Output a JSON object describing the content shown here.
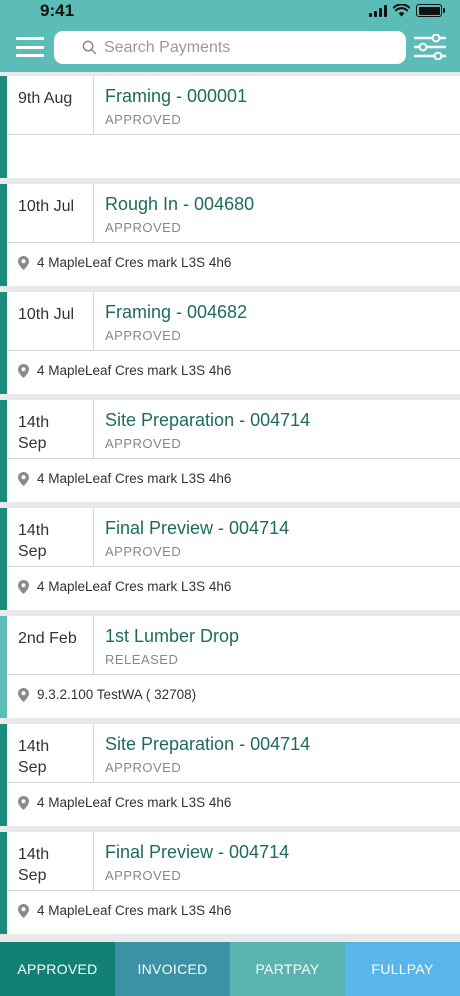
{
  "status_bar": {
    "time": "9:41"
  },
  "search": {
    "placeholder": "Search Payments",
    "value": ""
  },
  "payments": [
    {
      "date": "9th Aug",
      "title": "Framing - 000001",
      "status": "APPROVED",
      "address": ""
    },
    {
      "date": "10th Jul",
      "title": "Rough In - 004680",
      "status": "APPROVED",
      "address": "4 MapleLeaf Cres mark L3S 4h6"
    },
    {
      "date": "10th Jul",
      "title": "Framing - 004682",
      "status": "APPROVED",
      "address": "4 MapleLeaf Cres mark L3S 4h6"
    },
    {
      "date": "14th Sep",
      "title": "Site Preparation - 004714",
      "status": "APPROVED",
      "address": "4 MapleLeaf Cres mark L3S 4h6"
    },
    {
      "date": "14th Sep",
      "title": "Final Preview - 004714",
      "status": "APPROVED",
      "address": "4 MapleLeaf Cres mark L3S 4h6"
    },
    {
      "date": "2nd Feb",
      "title": "1st Lumber Drop",
      "status": "RELEASED",
      "address": "9.3.2.100 TestWA ( 32708)"
    },
    {
      "date": "14th Sep",
      "title": "Site Preparation - 004714",
      "status": "APPROVED",
      "address": "4 MapleLeaf Cres mark L3S 4h6"
    },
    {
      "date": "14th Sep",
      "title": "Final Preview - 004714",
      "status": "APPROVED",
      "address": "4 MapleLeaf Cres mark L3S 4h6"
    }
  ],
  "tabs": [
    {
      "label": "APPROVED"
    },
    {
      "label": "INVOICED"
    },
    {
      "label": "PARTPAY"
    },
    {
      "label": "FULLPAY"
    }
  ],
  "colors": {
    "header": "#5cbcb8",
    "approved_accent": "#1b8b7d",
    "released_accent": "#5cbcb8",
    "title_text": "#1e6b5e"
  },
  "icons": [
    "menu-icon",
    "search-icon",
    "filter-sliders-icon",
    "location-pin-icon",
    "signal-icon",
    "wifi-icon",
    "battery-icon"
  ]
}
